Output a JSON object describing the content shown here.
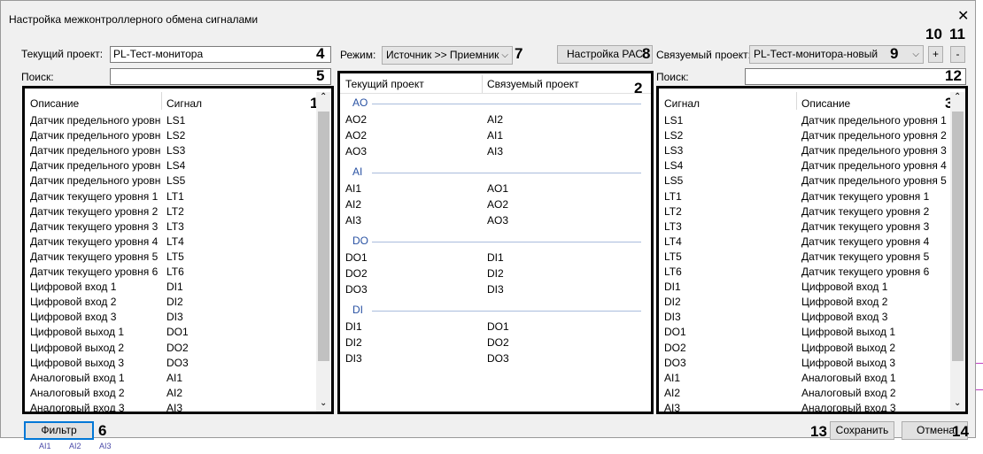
{
  "dialog": {
    "title": "Настройка межконтроллерного обмена сигналами",
    "close_glyph": "✕"
  },
  "current_project": {
    "label": "Текущий проект:",
    "value": "PL-Тест-монитора"
  },
  "mode": {
    "label": "Режим:",
    "value": "Источник >> Приемник"
  },
  "pac_button": {
    "label": "Настройка РАС"
  },
  "linked_project": {
    "label": "Связуемый проект:",
    "value": "PL-Тест-монитора-новый"
  },
  "plus_button": {
    "label": "+"
  },
  "minus_button": {
    "label": "-"
  },
  "search_left": {
    "label": "Поиск:",
    "value": ""
  },
  "search_right": {
    "label": "Поиск:",
    "value": ""
  },
  "left_table": {
    "headers": [
      "Описание",
      "Сигнал"
    ],
    "rows": [
      [
        "Датчик предельного уровн...",
        "LS1"
      ],
      [
        "Датчик предельного уровн...",
        "LS2"
      ],
      [
        "Датчик предельного уровн...",
        "LS3"
      ],
      [
        "Датчик предельного уровн...",
        "LS4"
      ],
      [
        "Датчик предельного уровн...",
        "LS5"
      ],
      [
        "Датчик текущего уровня 1",
        "LT1"
      ],
      [
        "Датчик текущего уровня 2",
        "LT2"
      ],
      [
        "Датчик текущего уровня 3",
        "LT3"
      ],
      [
        "Датчик текущего уровня 4",
        "LT4"
      ],
      [
        "Датчик текущего уровня 5",
        "LT5"
      ],
      [
        "Датчик текущего уровня 6",
        "LT6"
      ],
      [
        "Цифровой вход 1",
        "DI1"
      ],
      [
        "Цифровой вход 2",
        "DI2"
      ],
      [
        "Цифровой вход 3",
        "DI3"
      ],
      [
        "Цифровой выход 1",
        "DO1"
      ],
      [
        "Цифровой выход 2",
        "DO2"
      ],
      [
        "Цифровой выход 3",
        "DO3"
      ],
      [
        "Аналоговый вход 1",
        "AI1"
      ],
      [
        "Аналоговый вход 2",
        "AI2"
      ],
      [
        "Аналоговый вход 3",
        "AI3"
      ]
    ]
  },
  "middle_table": {
    "headers": [
      "Текущий проект",
      "Связуемый проект"
    ],
    "groups": [
      {
        "name": "AO",
        "rows": [
          [
            "AO2",
            "AI2"
          ],
          [
            "AO2",
            "AI1"
          ],
          [
            "AO3",
            "AI3"
          ]
        ]
      },
      {
        "name": "AI",
        "rows": [
          [
            "AI1",
            "AO1"
          ],
          [
            "AI2",
            "AO2"
          ],
          [
            "AI3",
            "AO3"
          ]
        ]
      },
      {
        "name": "DO",
        "rows": [
          [
            "DO1",
            "DI1"
          ],
          [
            "DO2",
            "DI2"
          ],
          [
            "DO3",
            "DI3"
          ]
        ]
      },
      {
        "name": "DI",
        "rows": [
          [
            "DI1",
            "DO1"
          ],
          [
            "DI2",
            "DO2"
          ],
          [
            "DI3",
            "DO3"
          ]
        ]
      }
    ]
  },
  "right_table": {
    "headers": [
      "Сигнал",
      "Описание"
    ],
    "rows": [
      [
        "LS1",
        "Датчик предельного уровня 1"
      ],
      [
        "LS2",
        "Датчик предельного уровня 2"
      ],
      [
        "LS3",
        "Датчик предельного уровня 3"
      ],
      [
        "LS4",
        "Датчик предельного уровня 4"
      ],
      [
        "LS5",
        "Датчик предельного уровня 5"
      ],
      [
        "LT1",
        "Датчик текущего уровня 1"
      ],
      [
        "LT2",
        "Датчик текущего уровня 2"
      ],
      [
        "LT3",
        "Датчик текущего уровня 3"
      ],
      [
        "LT4",
        "Датчик текущего уровня 4"
      ],
      [
        "LT5",
        "Датчик текущего уровня 5"
      ],
      [
        "LT6",
        "Датчик текущего уровня 6"
      ],
      [
        "DI1",
        "Цифровой вход 1"
      ],
      [
        "DI2",
        "Цифровой вход 2"
      ],
      [
        "DI3",
        "Цифровой вход 3"
      ],
      [
        "DO1",
        "Цифровой выход 1"
      ],
      [
        "DO2",
        "Цифровой выход 2"
      ],
      [
        "DO3",
        "Цифровой выход 3"
      ],
      [
        "AI1",
        "Аналоговый вход 1"
      ],
      [
        "AI2",
        "Аналоговый вход 2"
      ],
      [
        "AI3",
        "Аналоговый вход 3"
      ]
    ]
  },
  "filter_button": {
    "label": "Фильтр"
  },
  "save_button": {
    "label": "Сохранить"
  },
  "cancel_button": {
    "label": "Отмена"
  },
  "callouts": {
    "n1": "1",
    "n2": "2",
    "n3": "3",
    "n4": "4",
    "n5": "5",
    "n6": "6",
    "n7": "7",
    "n8": "8",
    "n9": "9",
    "n10": "10",
    "n11": "11",
    "n12": "12",
    "n13": "13",
    "n14": "14"
  },
  "background_fragment": {
    "labels": [
      "AI1",
      "AI2",
      "AI3"
    ]
  },
  "colors": {
    "group_title": "#2952a3",
    "focus_border": "#0078d7",
    "dialog_bg": "#f0f0f0"
  }
}
